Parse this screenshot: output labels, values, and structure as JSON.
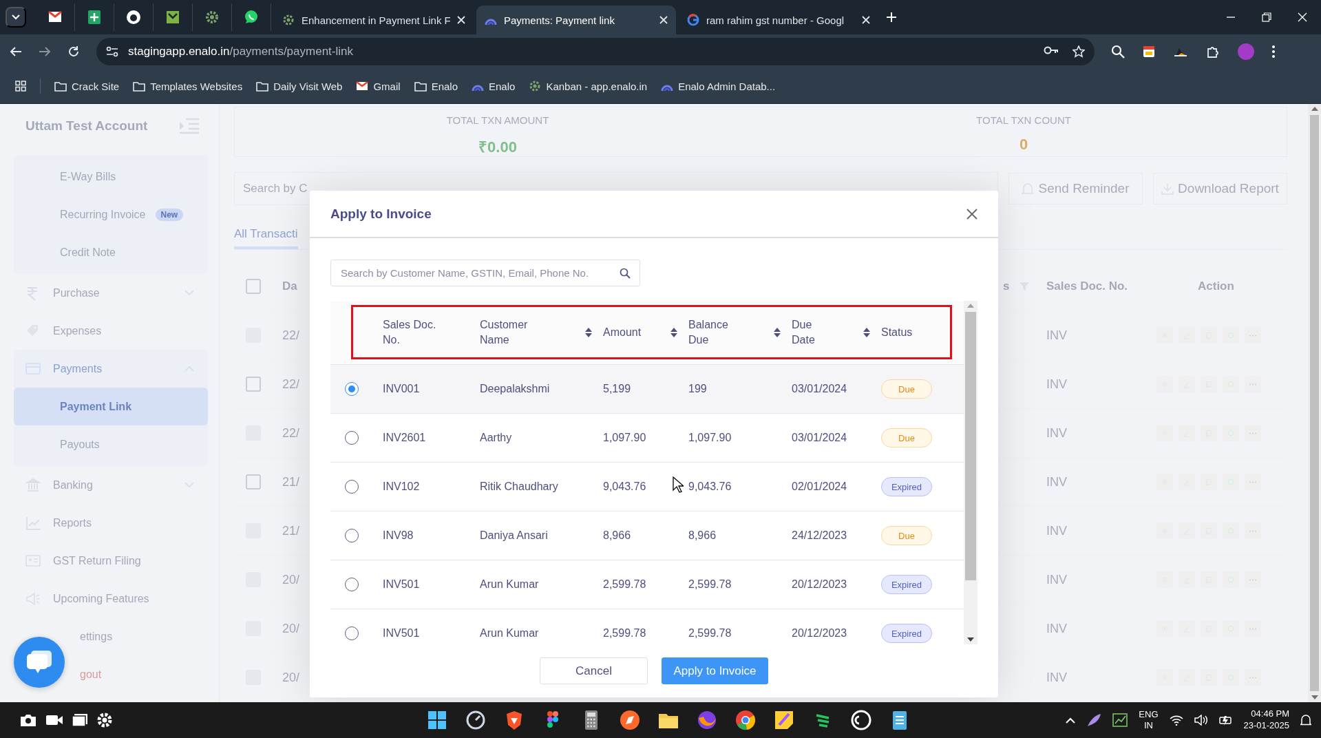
{
  "browser": {
    "tabs": [
      {
        "title": "Enhancement in Payment Link F",
        "kind": "gear",
        "selected": false
      },
      {
        "title": "Payments: Payment link",
        "kind": "enalo",
        "selected": true
      },
      {
        "title": "ram rahim gst number - Googl",
        "kind": "google",
        "selected": false
      }
    ],
    "url_host": "stagingapp.enalo.in",
    "url_path": "/payments/payment-link",
    "bookmarks": [
      {
        "label": "Crack Site",
        "kind": "folder"
      },
      {
        "label": "Templates Websites",
        "kind": "folder"
      },
      {
        "label": "Daily Visit Web",
        "kind": "folder"
      },
      {
        "label": "Gmail",
        "kind": "gmail"
      },
      {
        "label": "Enalo",
        "kind": "folder"
      },
      {
        "label": "Enalo",
        "kind": "enalo"
      },
      {
        "label": "Kanban - app.enalo.in",
        "kind": "gear"
      },
      {
        "label": "Enalo Admin Datab...",
        "kind": "enalo"
      }
    ]
  },
  "sidebar": {
    "title": "Uttam Test Account",
    "items": [
      {
        "kind": "group",
        "children": [
          {
            "label": "E-Way Bills",
            "selected": false
          },
          {
            "label": "Recurring Invoice",
            "badge": "New",
            "selected": false
          },
          {
            "label": "Credit Note",
            "selected": false
          }
        ]
      },
      {
        "kind": "rupee",
        "label": "Purchase",
        "expanded": false
      },
      {
        "kind": "tag",
        "label": "Expenses"
      },
      {
        "kind": "card",
        "label": "Payments",
        "expanded": true,
        "active": true
      },
      {
        "kind": "group",
        "children": [
          {
            "label": "Payment Link",
            "selected": true
          },
          {
            "label": "Payouts",
            "selected": false
          }
        ]
      },
      {
        "kind": "bank",
        "label": "Banking",
        "expanded": false
      },
      {
        "kind": "chart",
        "label": "Reports"
      },
      {
        "kind": "idcard",
        "label": "GST Return Filing"
      },
      {
        "kind": "speaker",
        "label": "Upcoming Features"
      },
      {
        "kind": "covered",
        "label": "ettings"
      },
      {
        "kind": "logout",
        "label": "gout"
      }
    ]
  },
  "stats": [
    {
      "label": "TOTAL TXN AMOUNT",
      "value": "₹0.00",
      "kind": "amount"
    },
    {
      "label": "TOTAL TXN COUNT",
      "value": "0",
      "kind": "count"
    }
  ],
  "toolbar": {
    "search_placeholder": "Search by C",
    "actions": [
      {
        "label": "Send Reminder",
        "kind": "bell"
      },
      {
        "label": "Download Report",
        "kind": "download"
      }
    ]
  },
  "tabs": [
    {
      "label": "All Transacti",
      "selected": true
    }
  ],
  "table": {
    "columns": [
      "Da",
      "s",
      "Sales Doc. No.",
      "Action"
    ],
    "select_all_checked": false,
    "rows": [
      {
        "date": "22/",
        "doc": "INV",
        "checked": false,
        "disabled": true
      },
      {
        "date": "22/",
        "doc": "INV",
        "checked": false,
        "disabled": false
      },
      {
        "date": "22/",
        "doc": "INV",
        "checked": false,
        "disabled": true
      },
      {
        "date": "21/",
        "doc": "INV",
        "checked": false,
        "disabled": false
      },
      {
        "date": "21/",
        "doc": "INV",
        "checked": false,
        "disabled": true
      },
      {
        "date": "20/",
        "doc": "INV",
        "checked": false,
        "disabled": true
      },
      {
        "date": "20/",
        "doc": "INV",
        "checked": false,
        "disabled": true
      },
      {
        "date": "20/",
        "doc": "INV",
        "checked": false,
        "disabled": true
      }
    ]
  },
  "dialog": {
    "title": "Apply to Invoice",
    "search": {
      "placeholder": "Search by Customer Name, GSTIN, Email, Phone No."
    },
    "columns": [
      {
        "label": "Sales Doc. No.",
        "sortable": false
      },
      {
        "label": "Customer Name",
        "sortable": true
      },
      {
        "label": "Amount",
        "sortable": true
      },
      {
        "label": "Balance Due",
        "sortable": true
      },
      {
        "label": "Due Date",
        "sortable": true
      },
      {
        "label": "Status",
        "sortable": false
      }
    ],
    "rows": [
      {
        "selected": true,
        "doc": "INV001",
        "customer": "Deepalakshmi",
        "amount": "5,199",
        "balance": "199",
        "due_date": "03/01/2024",
        "status": "Due",
        "kind": "due"
      },
      {
        "selected": false,
        "doc": "INV2601",
        "customer": "Aarthy",
        "amount": "1,097.90",
        "balance": "1,097.90",
        "due_date": "03/01/2024",
        "status": "Due",
        "kind": "due"
      },
      {
        "selected": false,
        "doc": "INV102",
        "customer": "Ritik Chaudhary",
        "amount": "9,043.76",
        "balance": "9,043.76",
        "due_date": "02/01/2024",
        "status": "Expired",
        "kind": "expired"
      },
      {
        "selected": false,
        "doc": "INV98",
        "customer": "Daniya Ansari",
        "amount": "8,966",
        "balance": "8,966",
        "due_date": "24/12/2023",
        "status": "Due",
        "kind": "due"
      },
      {
        "selected": false,
        "doc": "INV501",
        "customer": "Arun Kumar",
        "amount": "2,599.78",
        "balance": "2,599.78",
        "due_date": "20/12/2023",
        "status": "Expired",
        "kind": "expired"
      },
      {
        "selected": false,
        "doc": "INV501",
        "customer": "Arun Kumar",
        "amount": "2,599.78",
        "balance": "2,599.78",
        "due_date": "20/12/2023",
        "status": "Expired",
        "kind": "expired"
      }
    ],
    "buttons": [
      {
        "label": "Cancel",
        "kind": "secondary"
      },
      {
        "label": "Apply to Invoice",
        "kind": "primary"
      }
    ]
  },
  "taskbar": {
    "language": "ENG",
    "region": "IN",
    "time": "04:46 PM",
    "date": "23-01-2025"
  }
}
